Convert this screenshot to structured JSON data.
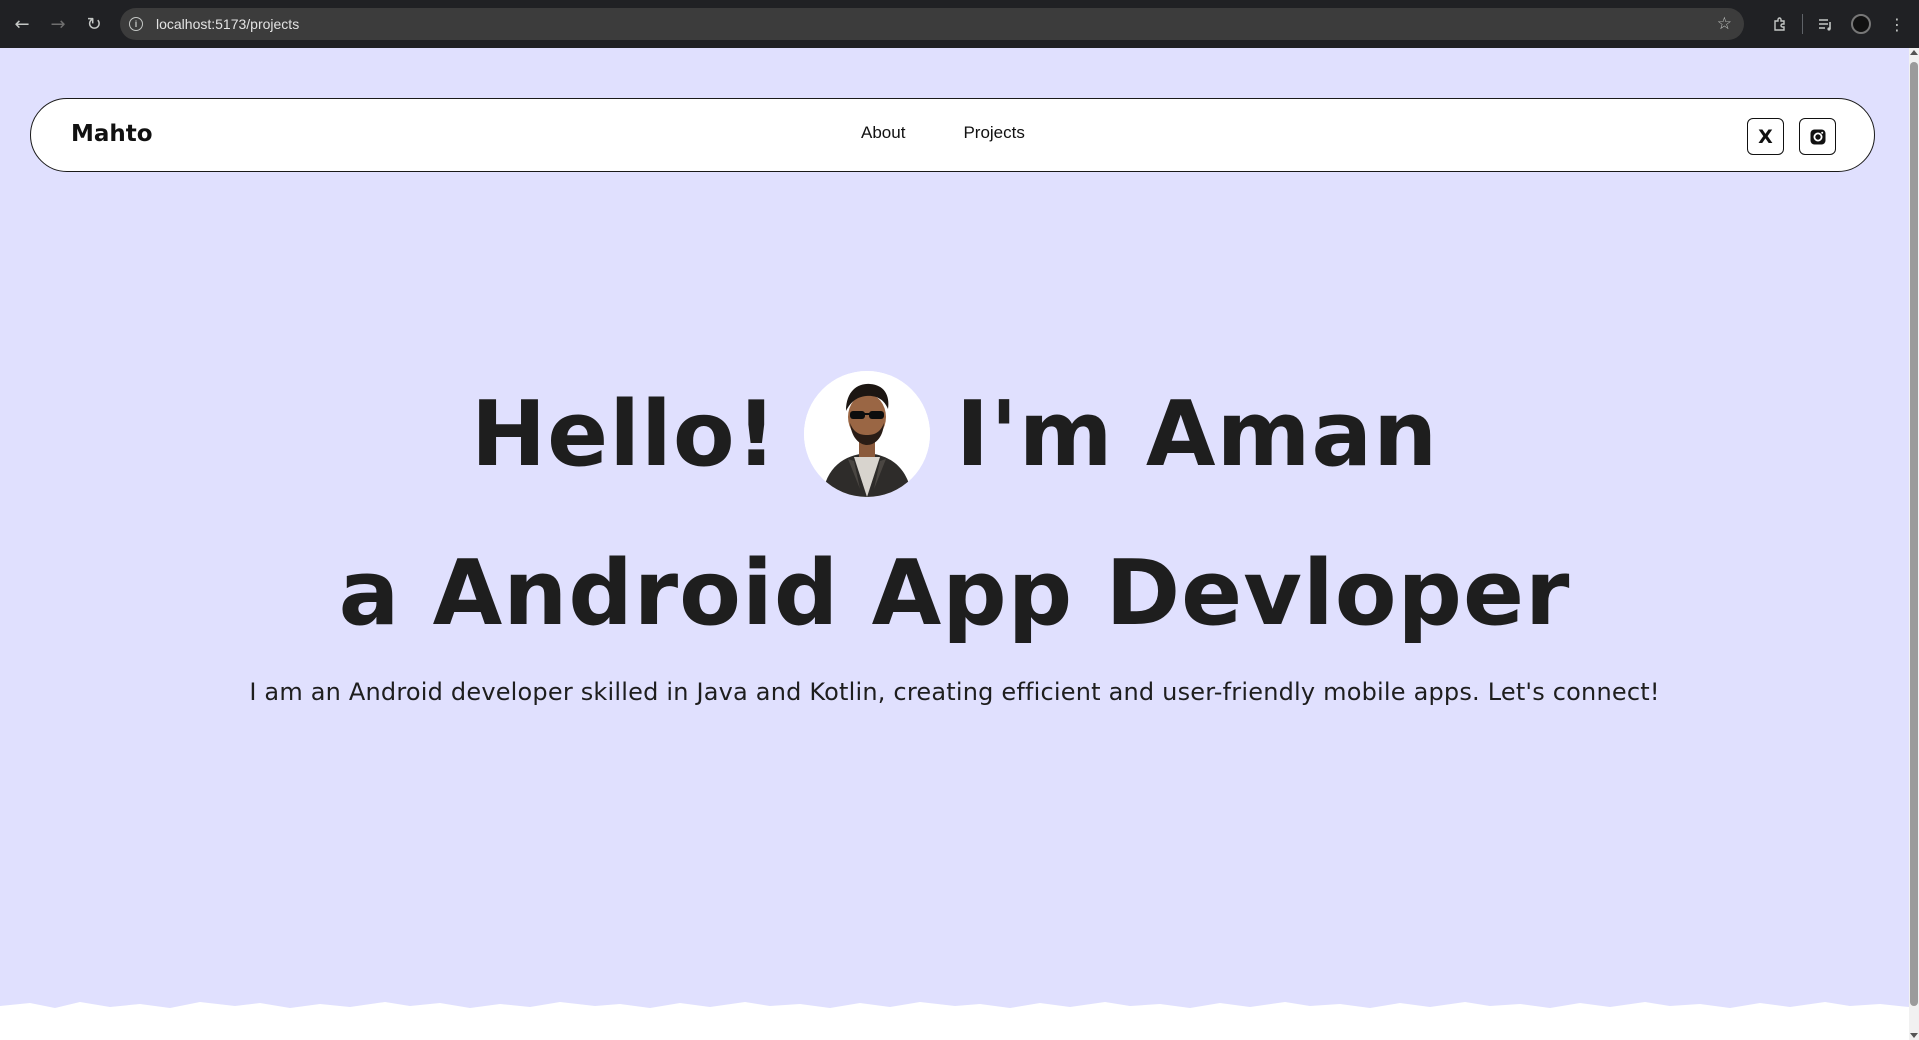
{
  "browser": {
    "url": "localhost:5173/projects"
  },
  "navbar": {
    "brand": "Mahto",
    "links": [
      "About",
      "Projects"
    ],
    "social_x_label": "X",
    "social_icons": [
      "x-icon",
      "instagram-icon"
    ]
  },
  "hero": {
    "greeting": "Hello!",
    "name": "I'm Aman",
    "role": "a Android App Devloper",
    "description": "I am an Android developer skilled in Java and Kotlin, creating efficient and user-friendly mobile apps. Let's connect!"
  },
  "colors": {
    "background": "#e0e0fe",
    "text": "#1e1e1e",
    "navbar_bg": "#ffffff",
    "chrome": "#202124"
  }
}
